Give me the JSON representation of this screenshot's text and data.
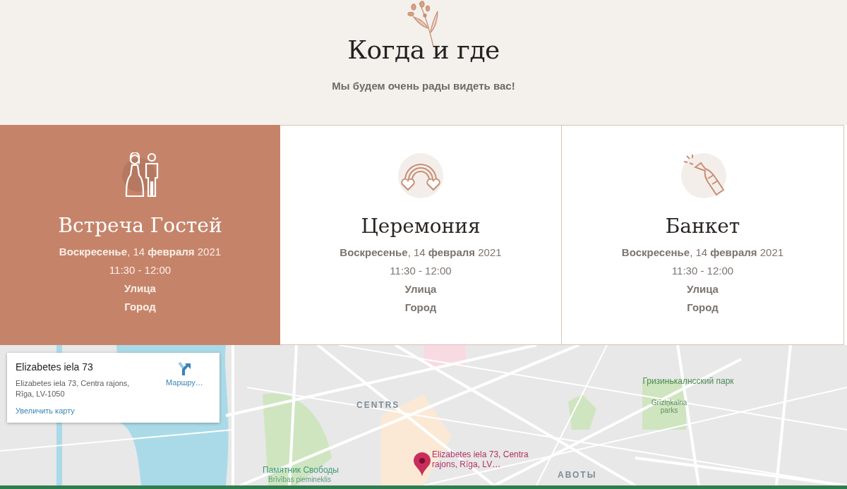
{
  "header": {
    "title": "Когда и где",
    "subtitle": "Мы будем очень рады видеть вас!"
  },
  "events": [
    {
      "kind": "couple",
      "selected": true,
      "title": "Встреча Гостей",
      "date": "**Воскресенье**, 14 **февраля** 2021",
      "time": "11:30 - 12:00",
      "street": "Улица",
      "city": "Город"
    },
    {
      "kind": "rainbow",
      "selected": false,
      "title": "Церемония",
      "date": "**Воскресенье**, 14 **февраля** 2021",
      "time": "11:30 - 12:00",
      "street": "Улица",
      "city": "Город"
    },
    {
      "kind": "champagne",
      "selected": false,
      "title": "Банкет",
      "date": "**Воскресенье**, 14 **февраля** 2021",
      "time": "11:30 - 12:00",
      "street": "Улица",
      "city": "Город"
    }
  ],
  "map": {
    "place_card": {
      "name": "Elizabetes iela 73",
      "address": "Elizabetes iela 73, Centra rajons, Rīga, LV-1050",
      "directions": "Маршру…",
      "enlarge": "Увеличить карту"
    },
    "marker_label": "Elizabetes iela 73, Centra rajons, Rīga, LV…",
    "labels": [
      {
        "kind": "district",
        "text": "CENTRS"
      },
      {
        "kind": "park",
        "text": "Гризинькалнсский парк"
      },
      {
        "kind": "park-sub",
        "text": "Grīziņkalna parks"
      },
      {
        "kind": "landmark",
        "text": "Памятник Свободы"
      },
      {
        "kind": "landmark-sub",
        "text": "Brīvības piemineklis"
      },
      {
        "kind": "district",
        "text": "АВОТЫ"
      }
    ]
  }
}
